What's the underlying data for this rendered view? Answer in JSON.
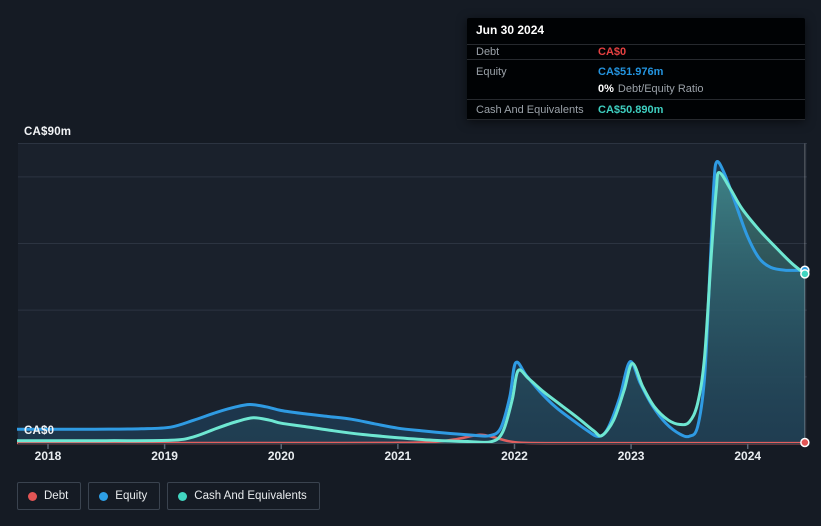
{
  "tooltip": {
    "date": "Jun 30 2024",
    "debt_label": "Debt",
    "debt_value": "CA$0",
    "equity_label": "Equity",
    "equity_value": "CA$51.976m",
    "ratio_pct": "0%",
    "ratio_text": "Debt/Equity Ratio",
    "cash_label": "Cash And Equivalents",
    "cash_value": "CA$50.890m"
  },
  "axis": {
    "y_top_label": "CA$90m",
    "y_bottom_label": "CA$0",
    "x_labels": [
      "2018",
      "2019",
      "2020",
      "2021",
      "2022",
      "2023",
      "2024"
    ]
  },
  "legend": [
    {
      "label": "Debt",
      "color": "#e25555"
    },
    {
      "label": "Equity",
      "color": "#2d9fe6"
    },
    {
      "label": "Cash And Equivalents",
      "color": "#41d5c0"
    }
  ],
  "colors": {
    "debt_value": "#e64141",
    "equity_value": "#2394df",
    "cash_value": "#3ecfc0",
    "debt_line": "#e15f5f",
    "equity_line": "#2f9be3",
    "cash_line": "#6ee7d2",
    "equity_fill": "#1e3a52",
    "cash_fill_top": "rgba(105,226,208,0.50)",
    "cash_fill_bottom": "rgba(45,95,105,0.16)",
    "gridline": "#2c3441",
    "baseline": "#39434e",
    "tick": "#5a6572",
    "hover_line": "rgba(255,255,255,0.32)",
    "marker_ring": "#ffffff"
  },
  "chart_data": {
    "type": "area",
    "title": "Debt to Equity History",
    "x_unit": "year",
    "x_range": [
      2017.74,
      2024.49
    ],
    "ylim": [
      0,
      90
    ],
    "y_gridlines_m": [
      90,
      80,
      60,
      40,
      20
    ],
    "legend_position": "bottom-left",
    "hover_x": 2024.49,
    "series": [
      {
        "name": "Equity",
        "unit": "CA$m",
        "points": [
          [
            2017.74,
            4.3
          ],
          [
            2018.0,
            4.3
          ],
          [
            2018.4,
            4.3
          ],
          [
            2018.8,
            4.4
          ],
          [
            2019.05,
            4.9
          ],
          [
            2019.25,
            7.0
          ],
          [
            2019.45,
            9.4
          ],
          [
            2019.6,
            10.9
          ],
          [
            2019.73,
            11.7
          ],
          [
            2019.87,
            11.0
          ],
          [
            2020.0,
            9.9
          ],
          [
            2020.2,
            8.9
          ],
          [
            2020.4,
            8.1
          ],
          [
            2020.6,
            7.3
          ],
          [
            2020.8,
            5.9
          ],
          [
            2021.0,
            4.6
          ],
          [
            2021.2,
            3.8
          ],
          [
            2021.45,
            3.0
          ],
          [
            2021.65,
            2.5
          ],
          [
            2021.78,
            2.3
          ],
          [
            2021.88,
            4.5
          ],
          [
            2021.96,
            14.0
          ],
          [
            2022.01,
            24.2
          ],
          [
            2022.1,
            20.5
          ],
          [
            2022.22,
            15.5
          ],
          [
            2022.35,
            11.0
          ],
          [
            2022.5,
            7.0
          ],
          [
            2022.62,
            4.0
          ],
          [
            2022.72,
            2.1
          ],
          [
            2022.8,
            4.5
          ],
          [
            2022.9,
            13.5
          ],
          [
            2022.99,
            24.5
          ],
          [
            2023.08,
            18.0
          ],
          [
            2023.18,
            11.5
          ],
          [
            2023.3,
            6.0
          ],
          [
            2023.42,
            2.8
          ],
          [
            2023.5,
            2.2
          ],
          [
            2023.57,
            5.0
          ],
          [
            2023.63,
            20.0
          ],
          [
            2023.68,
            55.0
          ],
          [
            2023.71,
            78.0
          ],
          [
            2023.735,
            84.5
          ],
          [
            2023.8,
            81.0
          ],
          [
            2023.9,
            71.5
          ],
          [
            2024.0,
            62.0
          ],
          [
            2024.1,
            55.5
          ],
          [
            2024.2,
            52.8
          ],
          [
            2024.32,
            52.0
          ],
          [
            2024.49,
            51.976
          ]
        ]
      },
      {
        "name": "Cash And Equivalents",
        "unit": "CA$m",
        "points": [
          [
            2017.74,
            0.85
          ],
          [
            2018.0,
            0.85
          ],
          [
            2018.5,
            0.85
          ],
          [
            2019.05,
            0.95
          ],
          [
            2019.25,
            2.0
          ],
          [
            2019.45,
            4.6
          ],
          [
            2019.62,
            6.6
          ],
          [
            2019.76,
            7.7
          ],
          [
            2019.9,
            7.0
          ],
          [
            2020.0,
            6.1
          ],
          [
            2020.2,
            5.1
          ],
          [
            2020.45,
            3.8
          ],
          [
            2020.7,
            2.7
          ],
          [
            2021.0,
            1.75
          ],
          [
            2021.3,
            1.0
          ],
          [
            2021.6,
            0.6
          ],
          [
            2021.8,
            0.55
          ],
          [
            2021.9,
            3.5
          ],
          [
            2021.98,
            13.0
          ],
          [
            2022.03,
            21.8
          ],
          [
            2022.12,
            19.5
          ],
          [
            2022.25,
            15.5
          ],
          [
            2022.4,
            11.5
          ],
          [
            2022.55,
            7.5
          ],
          [
            2022.68,
            3.8
          ],
          [
            2022.75,
            2.4
          ],
          [
            2022.85,
            7.0
          ],
          [
            2022.94,
            16.0
          ],
          [
            2023.01,
            24.0
          ],
          [
            2023.1,
            17.0
          ],
          [
            2023.2,
            11.0
          ],
          [
            2023.32,
            7.0
          ],
          [
            2023.42,
            5.7
          ],
          [
            2023.5,
            6.5
          ],
          [
            2023.57,
            12.0
          ],
          [
            2023.63,
            26.0
          ],
          [
            2023.69,
            58.0
          ],
          [
            2023.73,
            76.0
          ],
          [
            2023.755,
            81.3
          ],
          [
            2023.85,
            76.5
          ],
          [
            2023.95,
            70.5
          ],
          [
            2024.1,
            64.0
          ],
          [
            2024.25,
            58.5
          ],
          [
            2024.38,
            54.0
          ],
          [
            2024.49,
            50.89
          ]
        ]
      },
      {
        "name": "Debt",
        "unit": "CA$m",
        "points": [
          [
            2017.74,
            0.15
          ],
          [
            2018.5,
            0.15
          ],
          [
            2019.5,
            0.15
          ],
          [
            2020.5,
            0.15
          ],
          [
            2021.0,
            0.2
          ],
          [
            2021.3,
            0.45
          ],
          [
            2021.5,
            1.3
          ],
          [
            2021.7,
            2.6
          ],
          [
            2021.82,
            1.9
          ],
          [
            2021.95,
            0.7
          ],
          [
            2022.1,
            0.18
          ],
          [
            2022.5,
            0.12
          ],
          [
            2023.0,
            0.12
          ],
          [
            2023.5,
            0.12
          ],
          [
            2024.0,
            0.12
          ],
          [
            2024.49,
            0.12
          ]
        ]
      }
    ]
  }
}
